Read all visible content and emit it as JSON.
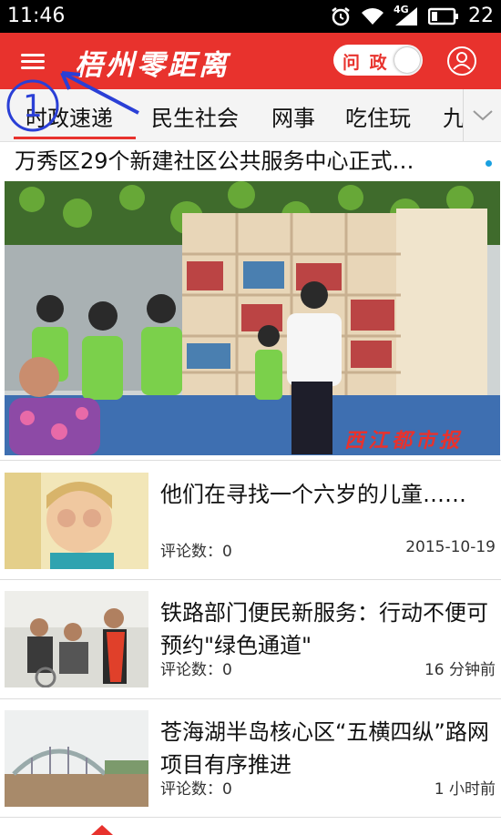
{
  "status_bar": {
    "time": "11:46",
    "network": "4G",
    "battery": "22",
    "icons": [
      "alarm-icon",
      "wifi-icon",
      "signal-icon",
      "battery-icon"
    ]
  },
  "header": {
    "app_title": "梧州零距离",
    "toggle_label": "问 政",
    "accent_color": "#e8322d"
  },
  "annotation": {
    "step_number": "1"
  },
  "tabs": {
    "items": [
      {
        "label": "时政速递",
        "selected": true
      },
      {
        "label": "民生社会",
        "selected": false
      },
      {
        "label": "网事",
        "selected": false
      },
      {
        "label": "吃住玩",
        "selected": false
      },
      {
        "label": "九",
        "selected": false
      }
    ]
  },
  "headline": {
    "title": "万秀区29个新建社区公共服务中心正式…"
  },
  "hero": {
    "watermark": "西江都市报"
  },
  "news": [
    {
      "title": "他们在寻找一个六岁的儿童……",
      "comments_label": "评论数：",
      "comments": "0",
      "time": "2015-10-19"
    },
    {
      "title": "铁路部门便民新服务：行动不便可预约\"绿色通道\"",
      "comments_label": "评论数：",
      "comments": "0",
      "time": "16 分钟前"
    },
    {
      "title": "苍海湖半岛核心区“五横四纵”路网项目有序推进",
      "comments_label": "评论数：",
      "comments": "0",
      "time": "1 小时前"
    }
  ]
}
